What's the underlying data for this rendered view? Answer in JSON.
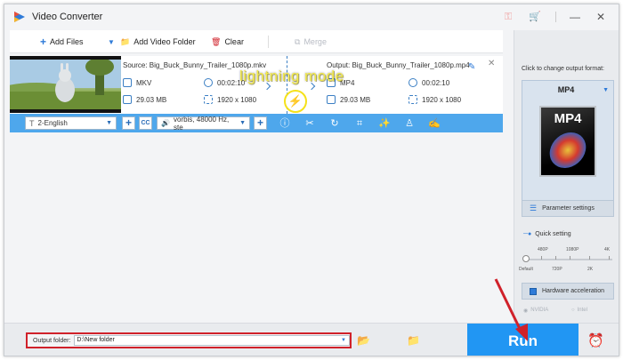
{
  "window": {
    "title": "Video Converter"
  },
  "toolbar": {
    "add_files": "Add Files",
    "add_video_folder": "Add Video Folder",
    "clear": "Clear",
    "merge": "Merge"
  },
  "task": {
    "source_name": "Source: Big_Buck_Bunny_Trailer_1080p.mkv",
    "output_name": "Output: Big_Buck_Bunny_Trailer_1080p.mp4",
    "source": {
      "format": "MKV",
      "duration": "00:02:10",
      "size": "29.03 MB",
      "resolution": "1920 x 1080"
    },
    "output": {
      "format": "MP4",
      "duration": "00:02:10",
      "size": "29.03 MB",
      "resolution": "1920 x 1080"
    },
    "lightning_label": "lightning mode"
  },
  "subbar": {
    "subtitle": "2-English",
    "cc": "CC",
    "audio": "vorbis, 48000 Hz, ste"
  },
  "right_panel": {
    "hint": "Click to change output format:",
    "format": "MP4",
    "format_badge": "MP4",
    "parameter_settings": "Parameter settings",
    "quick_setting": "Quick setting",
    "slider_top": [
      "480P",
      "1080P",
      "4K"
    ],
    "slider_bottom": [
      "Default",
      "720P",
      "2K"
    ],
    "hardware_acceleration": "Hardware acceleration",
    "gpu_nvidia": "NVIDIA",
    "gpu_intel": "Intel"
  },
  "bottom": {
    "output_folder_label": "Output folder:",
    "output_folder_value": "D:\\New folder",
    "run": "Run"
  },
  "colors": {
    "accent": "#2196f3",
    "subbar": "#4ea7ec",
    "highlight_red": "#d0212a",
    "lightning_yellow": "#f3ea4a"
  }
}
